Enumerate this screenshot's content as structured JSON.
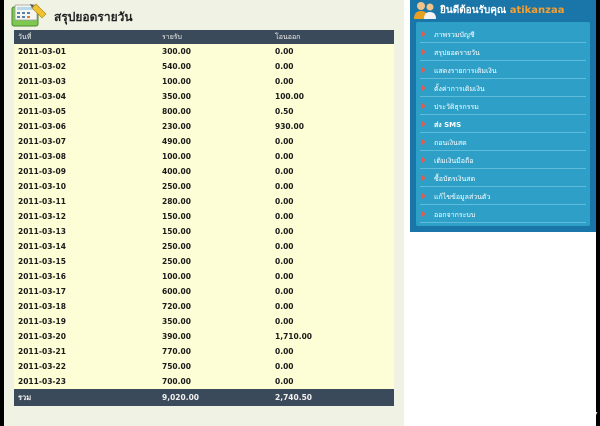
{
  "page_title": "สรุปยอดรายวัน",
  "table": {
    "columns": [
      "วันที่",
      "รายรับ",
      "โอนออก"
    ],
    "rows": [
      [
        "2011-03-01",
        "300.00",
        "0.00"
      ],
      [
        "2011-03-02",
        "540.00",
        "0.00"
      ],
      [
        "2011-03-03",
        "100.00",
        "0.00"
      ],
      [
        "2011-03-04",
        "350.00",
        "100.00"
      ],
      [
        "2011-03-05",
        "800.00",
        "0.50"
      ],
      [
        "2011-03-06",
        "230.00",
        "930.00"
      ],
      [
        "2011-03-07",
        "490.00",
        "0.00"
      ],
      [
        "2011-03-08",
        "100.00",
        "0.00"
      ],
      [
        "2011-03-09",
        "400.00",
        "0.00"
      ],
      [
        "2011-03-10",
        "250.00",
        "0.00"
      ],
      [
        "2011-03-11",
        "280.00",
        "0.00"
      ],
      [
        "2011-03-12",
        "150.00",
        "0.00"
      ],
      [
        "2011-03-13",
        "150.00",
        "0.00"
      ],
      [
        "2011-03-14",
        "250.00",
        "0.00"
      ],
      [
        "2011-03-15",
        "250.00",
        "0.00"
      ],
      [
        "2011-03-16",
        "100.00",
        "0.00"
      ],
      [
        "2011-03-17",
        "600.00",
        "0.00"
      ],
      [
        "2011-03-18",
        "720.00",
        "0.00"
      ],
      [
        "2011-03-19",
        "350.00",
        "0.00"
      ],
      [
        "2011-03-20",
        "390.00",
        "1,710.00"
      ],
      [
        "2011-03-21",
        "770.00",
        "0.00"
      ],
      [
        "2011-03-22",
        "750.00",
        "0.00"
      ],
      [
        "2011-03-23",
        "700.00",
        "0.00"
      ]
    ],
    "total": [
      "รวม",
      "9,020.00",
      "2,740.50"
    ]
  },
  "sidebar": {
    "welcome": "ยินดีต้อนรับคุณ",
    "username": "atikanzaa",
    "menu": [
      "ภาพรวมบัญชี",
      "สรุปยอดรายวัน",
      "แสดงรายการเติมเงิน",
      "ตั้งค่าการเติมเงิน",
      "ประวัติธุรกรรม",
      "ส่ง SMS",
      "ถอนเงินสด",
      "เติมเงินมือถือ",
      "ซื้อบัตรเงินสด",
      "แก้ไขข้อมูลส่วนตัว",
      "ออกจากระบบ"
    ]
  },
  "watermark": "[1147x778] https://upic.me/",
  "colors": {
    "table_header": "#3b4a5a",
    "row_bg": "#fdfdd6",
    "sidebar_outer": "#1a75a8",
    "sidebar_menu": "#2ea0c8",
    "username": "#f4a033"
  },
  "icons": {
    "header": "calculator-notebook-icon",
    "sidebar": "users-icon",
    "menu_bullet": "arrow-right-icon"
  }
}
